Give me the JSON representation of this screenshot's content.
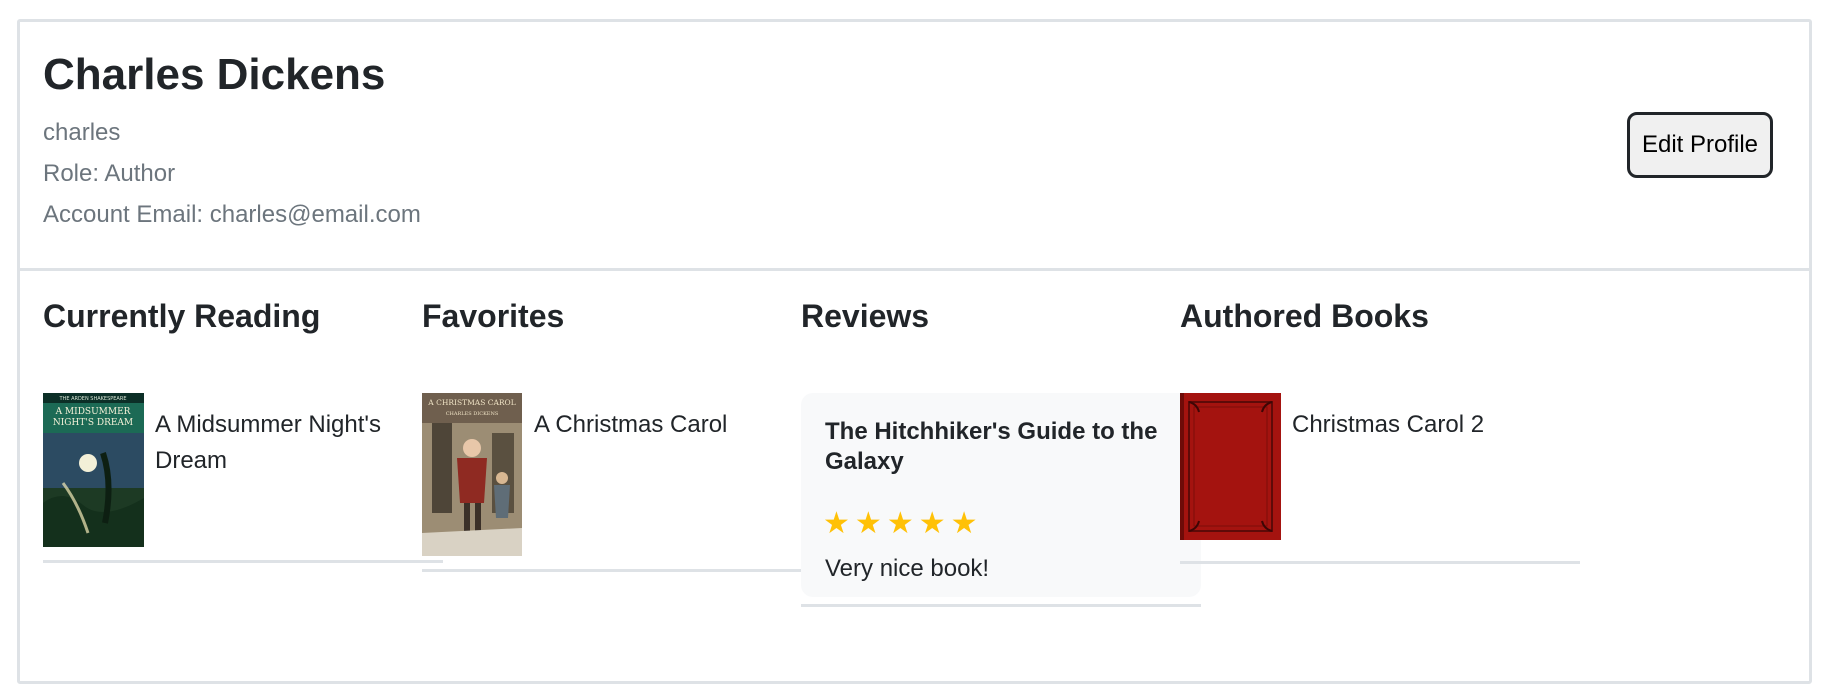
{
  "profile": {
    "name": "Charles Dickens",
    "username": "charles",
    "role_line": "Role: Author",
    "email_line": "Account Email: charles@email.com",
    "edit_button_label": "Edit Profile"
  },
  "sections": {
    "currently_reading": {
      "heading": "Currently Reading",
      "book_title": "A Midsummer Night's Dream",
      "cover_header": "THE ARDEN SHAKESPEARE",
      "cover_title_line1": "A MIDSUMMER",
      "cover_title_line2": "NIGHT'S DREAM"
    },
    "favorites": {
      "heading": "Favorites",
      "book_title": "A Christmas Carol",
      "cover_title": "A CHRISTMAS CAROL",
      "cover_author": "CHARLES DICKENS"
    },
    "reviews": {
      "heading": "Reviews",
      "review_title": "The Hitchhiker's Guide to the Galaxy",
      "rating": 5,
      "star_glyph": "★",
      "review_text": "Very nice book!"
    },
    "authored_books": {
      "heading": "Authored Books",
      "book_title": "Christmas Carol 2"
    }
  },
  "colors": {
    "star": "#ffc107",
    "border": "#dee2e6",
    "muted_text": "#6c757d",
    "review_card_bg": "#f8f9fa",
    "cover_red": "#a4130f"
  }
}
